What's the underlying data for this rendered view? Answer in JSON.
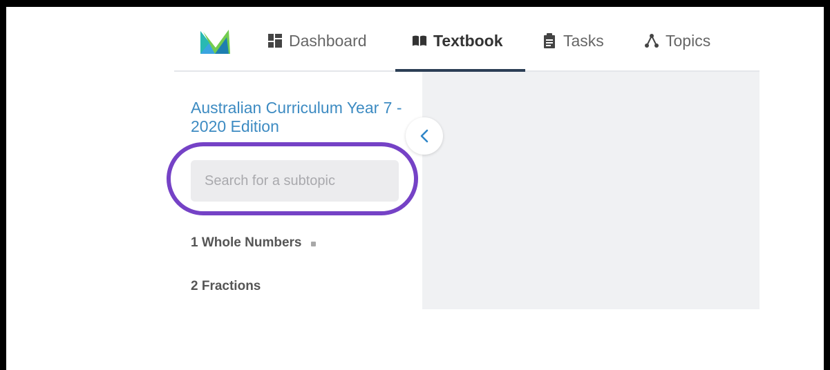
{
  "nav": {
    "items": [
      {
        "label": "Dashboard",
        "icon": "dashboard-icon",
        "active": false
      },
      {
        "label": "Textbook",
        "icon": "book-icon",
        "active": true
      },
      {
        "label": "Tasks",
        "icon": "clipboard-icon",
        "active": false
      },
      {
        "label": "Topics",
        "icon": "topics-icon",
        "active": false
      }
    ]
  },
  "sidebar": {
    "title": "Australian Curriculum Year 7 - 2020 Edition",
    "search": {
      "placeholder": "Search for a subtopic",
      "value": ""
    },
    "collapse_icon": "chevron-left-icon",
    "topics": [
      {
        "label": "1 Whole Numbers",
        "has_indicator": true
      },
      {
        "label": "2 Fractions",
        "has_indicator": false
      }
    ]
  },
  "colors": {
    "highlight_ring": "#7542c6",
    "title": "#3d8bc2",
    "active_underline": "#2c3e55",
    "content_background": "#f0f1f3"
  }
}
